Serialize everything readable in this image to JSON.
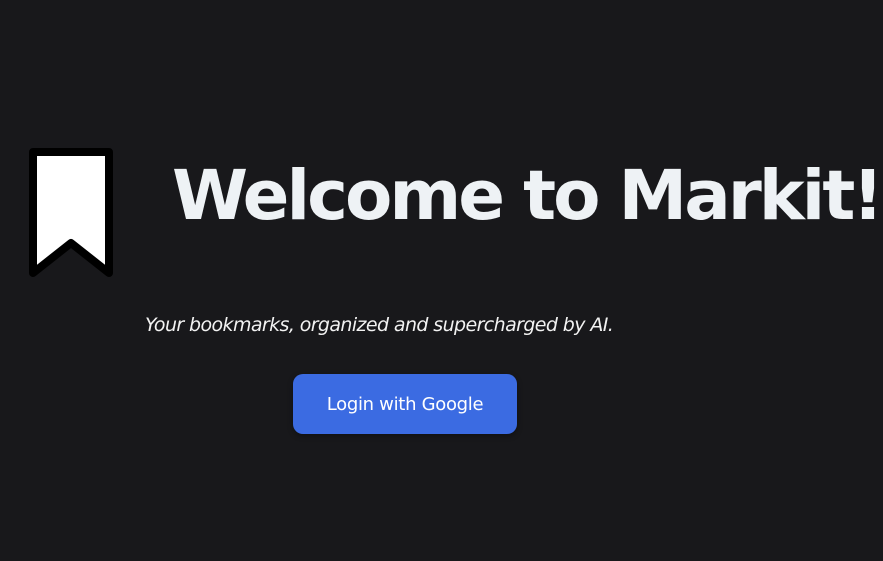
{
  "logo": {
    "icon": "bookmark-icon",
    "fill_color": "#ffffff",
    "stroke_color": "#000000"
  },
  "hero": {
    "title": "Welcome to Markit!",
    "tagline": "Your bookmarks, organized and supercharged by AI."
  },
  "auth": {
    "login_label": "Login with Google",
    "button_color": "#3b6be2"
  },
  "colors": {
    "background": "#18181b",
    "title_text": "#eef2f5"
  }
}
